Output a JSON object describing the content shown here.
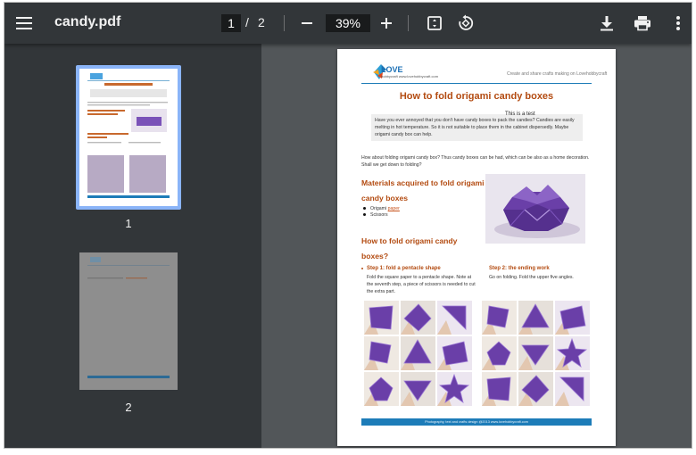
{
  "toolbar": {
    "file_name": "candy.pdf",
    "current_page": "1",
    "page_separator": "/",
    "total_pages": "2",
    "zoom": "39%",
    "icons": [
      "menu-icon",
      "zoom-out-icon",
      "zoom-in-icon",
      "fit-to-page-icon",
      "rotate-icon",
      "download-icon",
      "print-icon",
      "more-vert-icon"
    ]
  },
  "sidebar": {
    "thumbnails": [
      {
        "number": "1",
        "selected": true
      },
      {
        "number": "2",
        "selected": false
      }
    ]
  },
  "document": {
    "logo_text": "LOVE",
    "logo_subtext": "hobbycraft",
    "logo_url": "www.lovehobbycraft.com",
    "tagline": "Create and share crafts making on Lovehobbycraft",
    "title": "How to fold origami candy boxes",
    "test_label": "This is a test",
    "intro": "Have you ever annoyed that you don't have candy boxes to pack the candies? Candies are easily melting in hot temperature. So it is not suitable to place them in the cabinet dispersedly. Maybe origami candy box can help.",
    "paragraph": "How about folding origami candy box? Thus candy boxes can be had, which can be also as a home decoration. Shall we get down to folding?",
    "materials_heading": "Materials acquired to fold origami candy boxes",
    "materials": [
      {
        "prefix": "Origami ",
        "link": "paper"
      },
      {
        "prefix": "Scissors",
        "link": ""
      }
    ],
    "fold_heading": "How to fold origami candy boxes?",
    "step1_heading": "Step 1: fold a pentacle shape",
    "step1_text": "Fold the square paper to a pentacle shape. Note at the seventh step, a piece of scissors is needed to cut the extra part.",
    "step2_heading": "Step 2: the ending work",
    "step2_text": "Go on folding. Fold the upper five angles.",
    "footer": "Photography, text and crafts design @2013 www.lovehobbycraft.com"
  },
  "colors": {
    "toolbar_bg": "#323639",
    "viewer_bg": "#525659",
    "selected_thumb": "#8ab4f8",
    "heading_orange": "#b34b11",
    "accent_blue": "#1d7cb8",
    "paper_purple": "#6a3fa8"
  }
}
